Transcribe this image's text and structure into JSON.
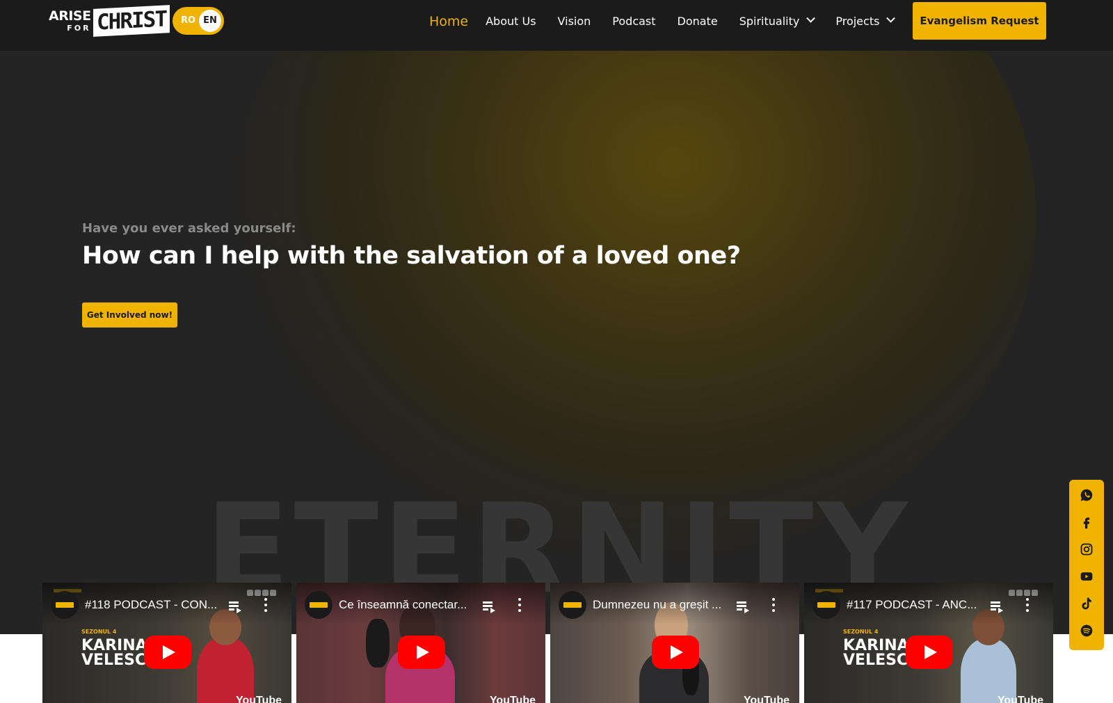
{
  "header": {
    "logo": {
      "line1": "ARISE",
      "line2": "FOR",
      "line3": "CHRIST"
    },
    "language": {
      "ro": "RO",
      "en": "EN",
      "selected": "EN"
    },
    "nav": [
      {
        "label": "Home",
        "active": true
      },
      {
        "label": "About Us"
      },
      {
        "label": "Vision"
      },
      {
        "label": "Podcast"
      },
      {
        "label": "Donate"
      },
      {
        "label": "Spirituality",
        "dropdown": true
      },
      {
        "label": "Projects",
        "dropdown": true
      }
    ],
    "cta_label": "Evangelism Request"
  },
  "hero": {
    "subtitle": "Have you ever asked yourself:",
    "title": "How can I help with the salvation of a loved one?",
    "button_label": "Get Involved now!",
    "background_word": "ETERNITY"
  },
  "videos": [
    {
      "title": "#118 PODCAST - CON...",
      "season": "SEZONUL 4",
      "name": "KARINA\nVELESCU",
      "watermark": "YouTube"
    },
    {
      "title": "Ce înseamnă conectar...",
      "watermark": "YouTube"
    },
    {
      "title": "Dumnezeu nu a greșit ...",
      "watermark": "YouTube"
    },
    {
      "title": "#117 PODCAST - ANC...",
      "season": "SEZONUL 4",
      "name": "KARINA\nVELESCU",
      "watermark": "YouTube"
    }
  ],
  "socials": [
    "whatsapp-icon",
    "facebook-icon",
    "instagram-icon",
    "youtube-icon",
    "tiktok-icon",
    "spotify-icon"
  ],
  "colors": {
    "accent": "#f0b400",
    "header_bg": "#1b1b1b",
    "hero_bg": "#242424",
    "play_red": "#ff0000"
  }
}
